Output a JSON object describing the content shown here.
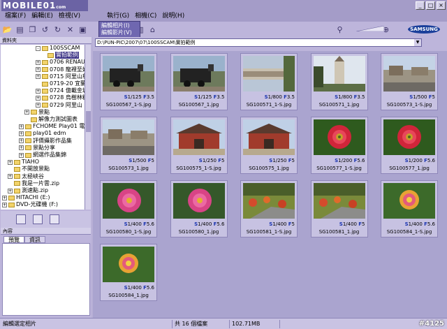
{
  "app": {
    "logo_text": "MOBILE01",
    "logo_sub": "com"
  },
  "window_controls": [
    "_",
    "□",
    "×"
  ],
  "menu": {
    "items": [
      "檔案(F)",
      "編輯(E)",
      "檢視(V)",
      "執行(G)",
      "相機(C)",
      "說明(H)"
    ]
  },
  "edit_dropdown": {
    "items": [
      "編輯相片(I)",
      "編輯影片(V)"
    ]
  },
  "brand": "SAMSUNG",
  "tree": {
    "header": "資料夾",
    "items": [
      {
        "label": "100SSCAM",
        "indent": 6,
        "exp": "-",
        "selected": false
      },
      {
        "label": "實拍範例",
        "indent": 7,
        "exp": "",
        "selected": true
      },
      {
        "label": "0706 RENAULT",
        "indent": 6,
        "exp": "+",
        "selected": false
      },
      {
        "label": "0708 龍裡至好望",
        "indent": 6,
        "exp": "+",
        "selected": false
      },
      {
        "label": "0715 阿里山慈穴",
        "indent": 6,
        "exp": "+",
        "selected": false
      },
      {
        "label": "0719-20 宜蘭通",
        "indent": 6,
        "exp": "",
        "selected": false
      },
      {
        "label": "0724 億載金城的",
        "indent": 6,
        "exp": "+",
        "selected": false
      },
      {
        "label": "0728 烏樹林糖廠",
        "indent": 6,
        "exp": "+",
        "selected": false
      },
      {
        "label": "0729 阿里山 Sh",
        "indent": 6,
        "exp": "+",
        "selected": false
      },
      {
        "label": "景點",
        "indent": 4,
        "exp": "+",
        "selected": false
      },
      {
        "label": "解像力測試圖表",
        "indent": 4,
        "exp": "",
        "selected": false
      },
      {
        "label": "FCHOME Play01 電子報",
        "indent": 3,
        "exp": "+",
        "selected": false
      },
      {
        "label": "play01 edm",
        "indent": 3,
        "exp": "+",
        "selected": false
      },
      {
        "label": "評價攝影作品集",
        "indent": 3,
        "exp": "+",
        "selected": false
      },
      {
        "label": "景點分享",
        "indent": 3,
        "exp": "+",
        "selected": false
      },
      {
        "label": "網選作品集錦",
        "indent": 3,
        "exp": "+",
        "selected": false
      },
      {
        "label": "TIAHO",
        "indent": 1,
        "exp": "+",
        "selected": false
      },
      {
        "label": "不開放景點",
        "indent": 1,
        "exp": "",
        "selected": false
      },
      {
        "label": "太極峽谷",
        "indent": 1,
        "exp": "+",
        "selected": false
      },
      {
        "label": "我是一片雲.zip",
        "indent": 1,
        "exp": "",
        "selected": false
      },
      {
        "label": "測速點.zip",
        "indent": 1,
        "exp": "+",
        "selected": false
      },
      {
        "label": "HITACHI (E:)",
        "indent": 0,
        "exp": "+",
        "selected": false
      },
      {
        "label": "DVD-光碟機 (F:)",
        "indent": 0,
        "exp": "+",
        "selected": false
      }
    ]
  },
  "info_panel": {
    "header": "內容",
    "tabs": [
      "預覽",
      "資訊"
    ]
  },
  "path": "D:\\PUN-PIC\\2007\\07\\100SSCAM\\實拍範例",
  "thumbnails": [
    {
      "shutter": "1/125",
      "aperture": "3.5",
      "name": "SG100567_1-S.jpg",
      "scene": "train"
    },
    {
      "shutter": "1/125",
      "aperture": "3.5",
      "name": "SG100567_1.jpg",
      "scene": "train"
    },
    {
      "shutter": "1/800",
      "aperture": "3.5",
      "name": "SG100571_1-S.jpg",
      "scene": "tower-rot"
    },
    {
      "shutter": "1/800",
      "aperture": "3.5",
      "name": "SG100571_1.jpg",
      "scene": "tower"
    },
    {
      "shutter": "1/500",
      "aperture": "5",
      "name": "SG100573_1-S.jpg",
      "scene": "street"
    },
    {
      "shutter": "1/500",
      "aperture": "5",
      "name": "SG100573_1.jpg",
      "scene": "street"
    },
    {
      "shutter": "1/250",
      "aperture": "5",
      "name": "SG100575_1-S.jpg",
      "scene": "gate"
    },
    {
      "shutter": "1/250",
      "aperture": "5",
      "name": "SG100575_1.jpg",
      "scene": "gate"
    },
    {
      "shutter": "1/200",
      "aperture": "5.6",
      "name": "SG100577_1-S.jpg",
      "scene": "flower-red"
    },
    {
      "shutter": "1/200",
      "aperture": "5.6",
      "name": "SG100577_1.jpg",
      "scene": "flower-red"
    },
    {
      "shutter": "1/400",
      "aperture": "5.6",
      "name": "SG100580_1-S.jpg",
      "scene": "flower-pink"
    },
    {
      "shutter": "1/400",
      "aperture": "5.6",
      "name": "SG100580_1.jpg",
      "scene": "flower-pink"
    },
    {
      "shutter": "1/400",
      "aperture": "5",
      "name": "SG100581_1-S.jpg",
      "scene": "garden"
    },
    {
      "shutter": "1/400",
      "aperture": "5",
      "name": "SG100581_1.jpg",
      "scene": "garden"
    },
    {
      "shutter": "1/400",
      "aperture": "5.6",
      "name": "SG100584_1-S.jpg",
      "scene": "lantana"
    },
    {
      "shutter": "1/400",
      "aperture": "5.6",
      "name": "SG100584_1.jpg",
      "scene": "lantana"
    }
  ],
  "exif_prefix": {
    "shutter": "S",
    "aperture": "F"
  },
  "status": {
    "left": "編輯選定相片",
    "count": "共 16 個檔案",
    "size": "102.71MB",
    "watermark": "#4125"
  }
}
